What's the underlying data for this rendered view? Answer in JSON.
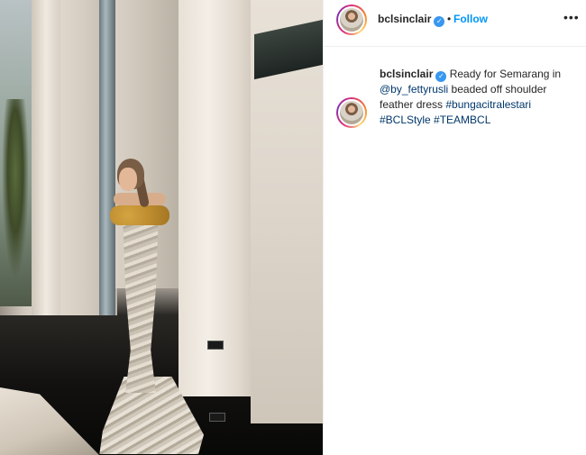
{
  "post": {
    "author": {
      "username": "bclsinclair",
      "verified_icon": "verified-badge-icon",
      "follow_label": "Follow",
      "more_label": "•••"
    },
    "caption": {
      "username": "bclsinclair",
      "text_before": " Ready for Semarang in ",
      "mention": "@by_fettyrusli",
      "text_after": " beaded off shoulder feather dress ",
      "tags": [
        "#bungacitralestari",
        "#BCLStyle",
        "#TEAMBCL"
      ]
    }
  },
  "colors": {
    "follow": "#0095f6",
    "link": "#00376b",
    "verified": "#3897f0"
  }
}
